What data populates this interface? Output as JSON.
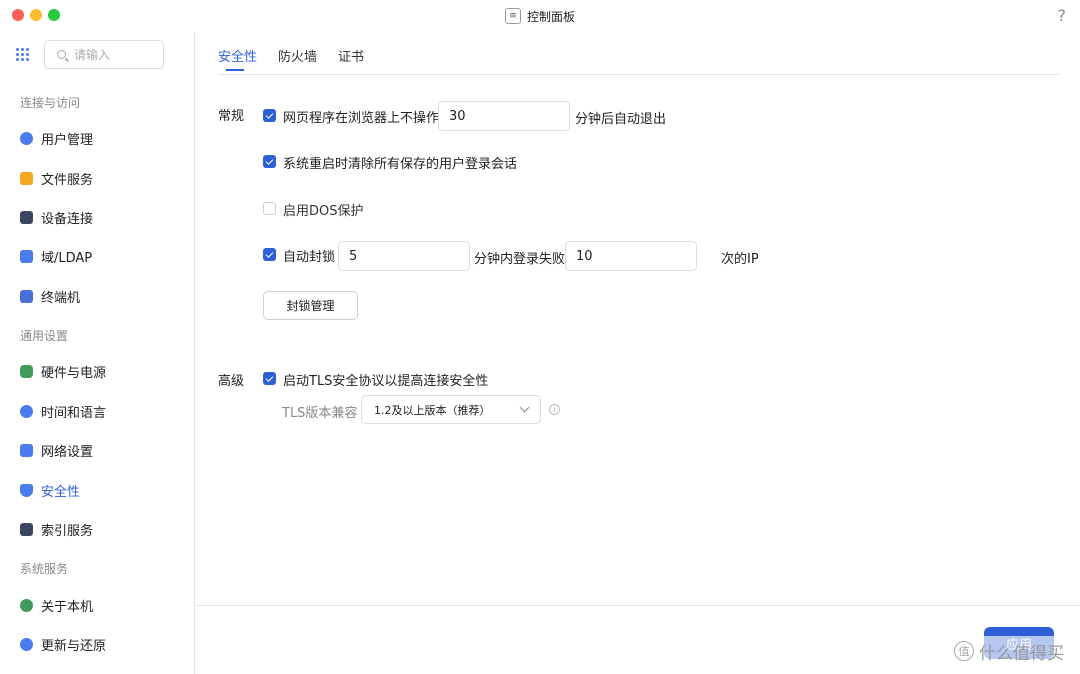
{
  "window": {
    "title": "控制面板",
    "help": "?"
  },
  "sidebar": {
    "search_placeholder": "请输入",
    "groups": [
      {
        "label": "连接与访问"
      },
      {
        "label": "通用设置"
      },
      {
        "label": "系统服务"
      }
    ],
    "items": [
      {
        "label": "用户管理",
        "icon": "users-icon",
        "color": "#4a7cf0"
      },
      {
        "label": "文件服务",
        "icon": "folder-icon",
        "color": "#f5a623"
      },
      {
        "label": "设备连接",
        "icon": "device-icon",
        "color": "#3b4660"
      },
      {
        "label": "域/LDAP",
        "icon": "ldap-icon",
        "color": "#4a7cf0"
      },
      {
        "label": "终端机",
        "icon": "terminal-icon",
        "color": "#4a6fd8"
      },
      {
        "label": "硬件与电源",
        "icon": "power-icon",
        "color": "#3f9a5b"
      },
      {
        "label": "时间和语言",
        "icon": "globe-icon",
        "color": "#4a7cf0"
      },
      {
        "label": "网络设置",
        "icon": "network-icon",
        "color": "#4a7cf0"
      },
      {
        "label": "安全性",
        "icon": "shield-icon",
        "color": "#4a7cf0",
        "active": true
      },
      {
        "label": "索引服务",
        "icon": "index-icon",
        "color": "#3b4660"
      },
      {
        "label": "关于本机",
        "icon": "about-icon",
        "color": "#3f9a5b"
      },
      {
        "label": "更新与还原",
        "icon": "update-icon",
        "color": "#4a7cf0"
      }
    ]
  },
  "tabs": [
    {
      "label": "安全性",
      "active": true
    },
    {
      "label": "防火墙"
    },
    {
      "label": "证书"
    }
  ],
  "general": {
    "label": "常规",
    "timeout": {
      "checked": true,
      "prefix": "网页程序在浏览器上不操作",
      "value": "30",
      "suffix": "分钟后自动退出"
    },
    "clear_sessions": {
      "checked": true,
      "label": "系统重启时清除所有保存的用户登录会话"
    },
    "dos": {
      "checked": false,
      "label": "启用DOS保护"
    },
    "auto_block": {
      "checked": true,
      "prefix": "自动封锁",
      "minutes": "5",
      "middle": "分钟内登录失败",
      "count": "10",
      "suffix": "次的IP"
    },
    "block_manage_button": "封锁管理"
  },
  "advanced": {
    "label": "高级",
    "tls": {
      "checked": true,
      "label": "启动TLS安全协议以提高连接安全性"
    },
    "tls_version_label": "TLS版本兼容",
    "tls_version_value": "1.2及以上版本（推荐）"
  },
  "footer": {
    "apply_button": "应用"
  },
  "watermark": {
    "text": "什么值得买",
    "mark": "值"
  },
  "colors": {
    "accent": "#2f5fd6"
  }
}
